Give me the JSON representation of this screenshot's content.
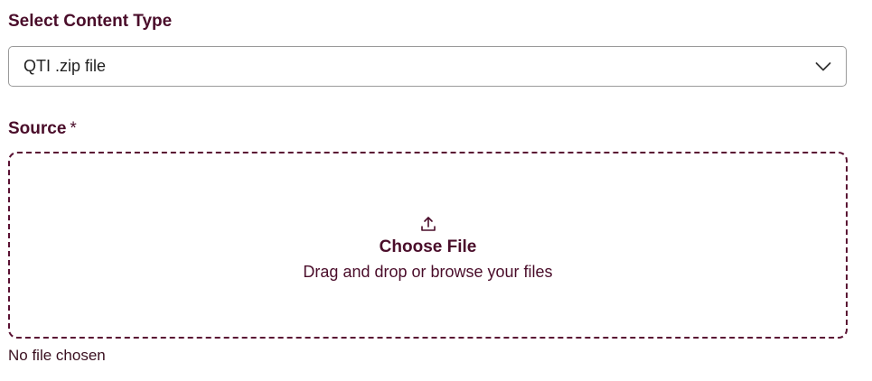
{
  "content_type": {
    "label": "Select Content Type",
    "selected": "QTI .zip file"
  },
  "source": {
    "label": "Source",
    "required_mark": "*",
    "dropzone": {
      "icon": "upload-icon",
      "title": "Choose File",
      "hint": "Drag and drop or browse your files"
    },
    "status": "No file chosen"
  },
  "colors": {
    "label": "#4a0d2a",
    "border_dashed": "#5a1133",
    "select_border": "#9a9a9a"
  }
}
